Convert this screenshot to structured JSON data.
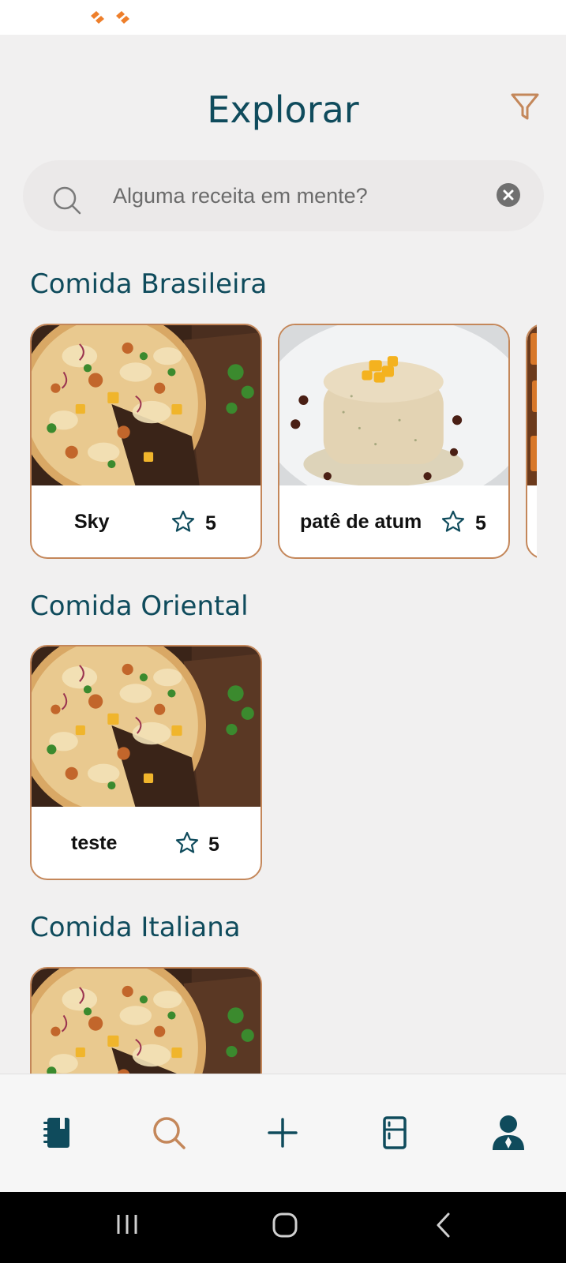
{
  "app": {
    "title": "Explorar",
    "accent_color": "#c4875a",
    "primary_color": "#0f4b5c"
  },
  "header": {
    "filter_icon": "filter-icon"
  },
  "search": {
    "placeholder": "Alguma receita em mente?",
    "value": "",
    "search_icon": "search-icon",
    "clear_icon": "clear-icon"
  },
  "sections": [
    {
      "title": "Comida Brasileira",
      "cards": [
        {
          "name": "Sky",
          "rating": "5",
          "image": "pizza-image"
        },
        {
          "name": "patê de atum",
          "rating": "5",
          "image": "tuna-pate-image"
        },
        {
          "name": "",
          "rating": "",
          "image": "food-image"
        }
      ]
    },
    {
      "title": "Comida Oriental",
      "cards": [
        {
          "name": "teste",
          "rating": "5",
          "image": "pizza-image"
        }
      ]
    },
    {
      "title": "Comida Italiana",
      "cards": [
        {
          "name": "",
          "rating": "",
          "image": "pizza-image"
        }
      ]
    }
  ],
  "bottom_nav": {
    "items": [
      {
        "icon": "recipe-book-icon",
        "active": false
      },
      {
        "icon": "search-icon",
        "active": true
      },
      {
        "icon": "plus-icon",
        "active": false
      },
      {
        "icon": "fridge-icon",
        "active": false
      },
      {
        "icon": "profile-icon",
        "active": false
      }
    ]
  },
  "system_nav": {
    "items": [
      "recent-apps-icon",
      "home-icon",
      "back-icon"
    ]
  }
}
